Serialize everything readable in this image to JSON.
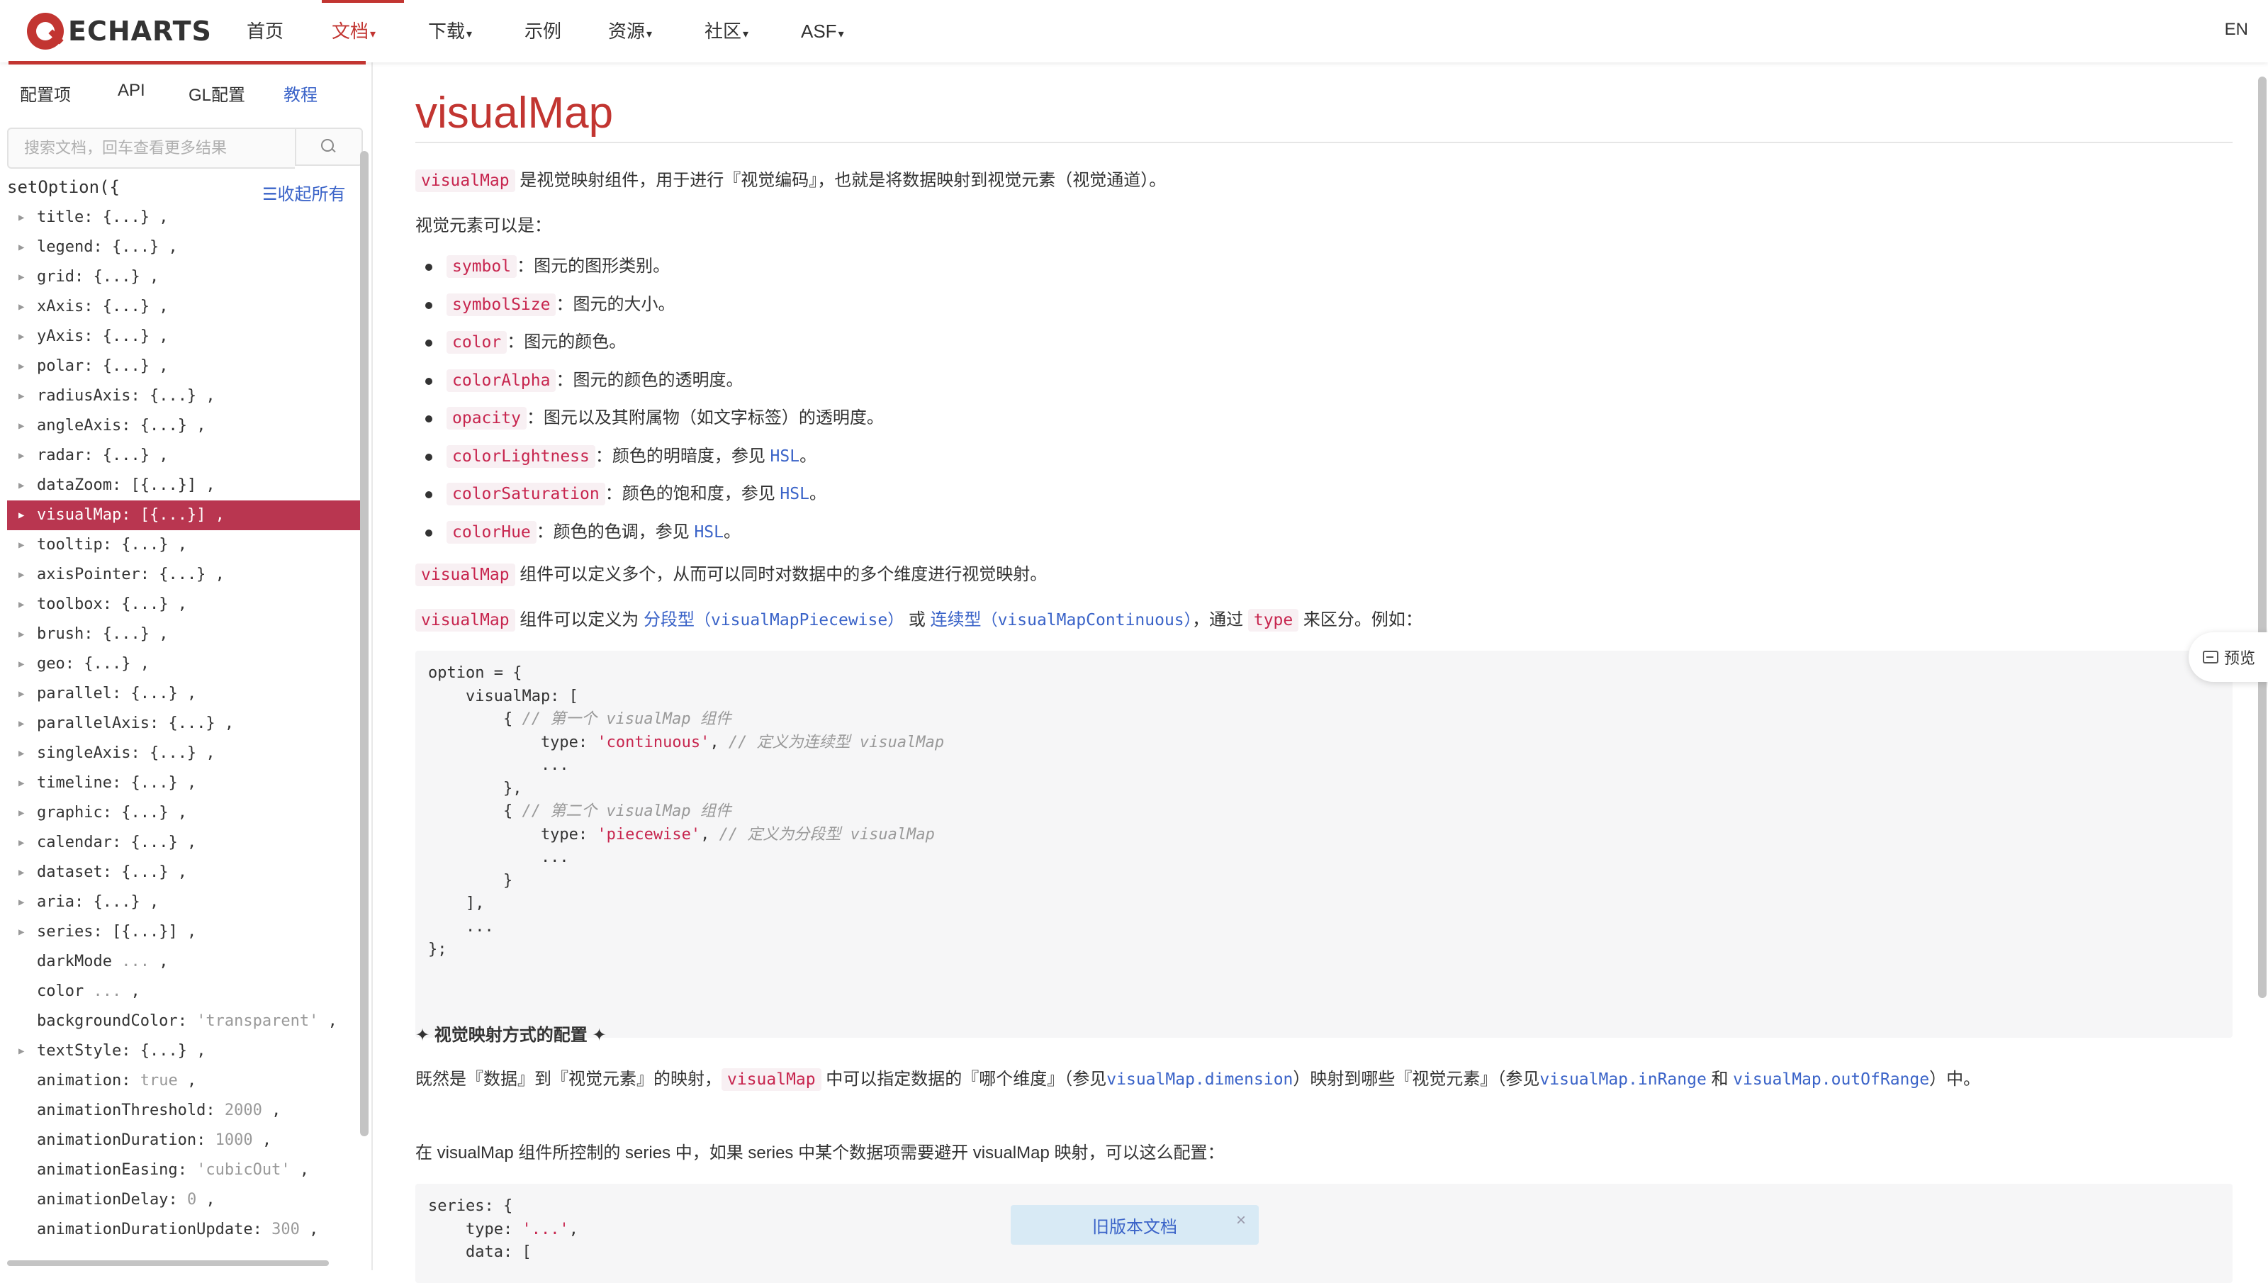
{
  "nav": {
    "logo_text": "ECHARTS",
    "items": [
      {
        "label": "首页",
        "caret": ""
      },
      {
        "label": "文档",
        "caret": "▾"
      },
      {
        "label": "下载",
        "caret": "▾"
      },
      {
        "label": "示例",
        "caret": ""
      },
      {
        "label": "资源",
        "caret": "▾"
      },
      {
        "label": "社区",
        "caret": "▾"
      },
      {
        "label": "ASF",
        "caret": "▾"
      }
    ],
    "lang": "EN",
    "accent": "#c23531"
  },
  "sidebar": {
    "tabs": [
      "配置项",
      "API",
      "GL配置",
      "教程"
    ],
    "search_placeholder": "搜索文档，回车查看更多结果",
    "setoption": "setOption({",
    "collapse_all": "☰收起所有",
    "tree": [
      {
        "key": "title",
        "val": "{...}",
        "arrow": true
      },
      {
        "key": "legend",
        "val": "{...}",
        "arrow": true
      },
      {
        "key": "grid",
        "val": "{...}",
        "arrow": true
      },
      {
        "key": "xAxis",
        "val": "{...}",
        "arrow": true
      },
      {
        "key": "yAxis",
        "val": "{...}",
        "arrow": true
      },
      {
        "key": "polar",
        "val": "{...}",
        "arrow": true
      },
      {
        "key": "radiusAxis",
        "val": "{...}",
        "arrow": true
      },
      {
        "key": "angleAxis",
        "val": "{...}",
        "arrow": true
      },
      {
        "key": "radar",
        "val": "{...}",
        "arrow": true
      },
      {
        "key": "dataZoom",
        "val": "[{...}]",
        "arrow": true
      },
      {
        "key": "visualMap",
        "val": "[{...}]",
        "arrow": true,
        "selected": true
      },
      {
        "key": "tooltip",
        "val": "{...}",
        "arrow": true
      },
      {
        "key": "axisPointer",
        "val": "{...}",
        "arrow": true
      },
      {
        "key": "toolbox",
        "val": "{...}",
        "arrow": true
      },
      {
        "key": "brush",
        "val": "{...}",
        "arrow": true
      },
      {
        "key": "geo",
        "val": "{...}",
        "arrow": true
      },
      {
        "key": "parallel",
        "val": "{...}",
        "arrow": true
      },
      {
        "key": "parallelAxis",
        "val": "{...}",
        "arrow": true
      },
      {
        "key": "singleAxis",
        "val": "{...}",
        "arrow": true
      },
      {
        "key": "timeline",
        "val": "{...}",
        "arrow": true
      },
      {
        "key": "graphic",
        "val": "{...}",
        "arrow": true
      },
      {
        "key": "calendar",
        "val": "{...}",
        "arrow": true
      },
      {
        "key": "dataset",
        "val": "{...}",
        "arrow": true
      },
      {
        "key": "aria",
        "val": "{...}",
        "arrow": true
      },
      {
        "key": "series",
        "val": "[{...}]",
        "arrow": true
      },
      {
        "key": "darkMode",
        "val": "...",
        "arrow": false,
        "plain": true
      },
      {
        "key": "color",
        "val": "...",
        "arrow": false,
        "plain": true
      },
      {
        "key": "backgroundColor",
        "val": "'transparent'",
        "arrow": false,
        "lit": true
      },
      {
        "key": "textStyle",
        "val": "{...}",
        "arrow": true
      },
      {
        "key": "animation",
        "val": "true",
        "arrow": false,
        "lit": true
      },
      {
        "key": "animationThreshold",
        "val": "2000",
        "arrow": false,
        "lit": true
      },
      {
        "key": "animationDuration",
        "val": "1000",
        "arrow": false,
        "lit": true
      },
      {
        "key": "animationEasing",
        "val": "'cubicOut'",
        "arrow": false,
        "lit": true
      },
      {
        "key": "animationDelay",
        "val": "0",
        "arrow": false,
        "lit": true
      },
      {
        "key": "animationDurationUpdate",
        "val": "300",
        "arrow": false,
        "lit": true
      }
    ]
  },
  "main": {
    "title": "visualMap",
    "intro_code": "visualMap",
    "intro_text": " 是视觉映射组件，用于进行『视觉编码』，也就是将数据映射到视觉元素（视觉通道）。",
    "elements_heading": "视觉元素可以是：",
    "bullets": [
      {
        "code": "symbol",
        "text": "：图元的图形类别。",
        "link": ""
      },
      {
        "code": "symbolSize",
        "text": "：图元的大小。",
        "link": ""
      },
      {
        "code": "color",
        "text": "：图元的颜色。",
        "link": ""
      },
      {
        "code": "colorAlpha",
        "text": "：图元的颜色的透明度。",
        "link": ""
      },
      {
        "code": "opacity",
        "text": "：图元以及其附属物（如文字标签）的透明度。",
        "link": ""
      },
      {
        "code": "colorLightness",
        "text": "：颜色的明暗度，参见 ",
        "link": "HSL",
        "tail": "。"
      },
      {
        "code": "colorSaturation",
        "text": "：颜色的饱和度，参见 ",
        "link": "HSL",
        "tail": "。"
      },
      {
        "code": "colorHue",
        "text": "：颜色的色调，参见 ",
        "link": "HSL",
        "tail": "。"
      }
    ],
    "multi_code": "visualMap",
    "multi_text": " 组件可以定义多个，从而可以同时对数据中的多个维度进行视觉映射。",
    "types": {
      "code": "visualMap",
      "t1": " 组件可以定义为 ",
      "link1": "分段型",
      "link1_code": "（visualMapPiecewise）",
      "t2": " 或 ",
      "link2": "连续型",
      "link2_code": "（visualMapContinuous）",
      "t3": "，通过 ",
      "code2": "type",
      "t4": " 来区分。例如："
    },
    "code1": [
      {
        "parts": [
          {
            "t": "option = {",
            "c": ""
          }
        ]
      },
      {
        "parts": [
          {
            "t": "    visualMap: [",
            "c": ""
          }
        ]
      },
      {
        "parts": [
          {
            "t": "        { ",
            "c": ""
          },
          {
            "t": "// 第一个 visualMap 组件",
            "c": "com"
          }
        ]
      },
      {
        "parts": [
          {
            "t": "            type: ",
            "c": ""
          },
          {
            "t": "'continuous'",
            "c": "str"
          },
          {
            "t": ", ",
            "c": ""
          },
          {
            "t": "// 定义为连续型 visualMap",
            "c": "com"
          }
        ]
      },
      {
        "parts": [
          {
            "t": "            ...",
            "c": ""
          }
        ]
      },
      {
        "parts": [
          {
            "t": "        },",
            "c": ""
          }
        ]
      },
      {
        "parts": [
          {
            "t": "        { ",
            "c": ""
          },
          {
            "t": "// 第二个 visualMap 组件",
            "c": "com"
          }
        ]
      },
      {
        "parts": [
          {
            "t": "            type: ",
            "c": ""
          },
          {
            "t": "'piecewise'",
            "c": "str"
          },
          {
            "t": ", ",
            "c": ""
          },
          {
            "t": "// 定义为分段型 visualMap",
            "c": "com"
          }
        ]
      },
      {
        "parts": [
          {
            "t": "            ...",
            "c": ""
          }
        ]
      },
      {
        "parts": [
          {
            "t": "        }",
            "c": ""
          }
        ]
      },
      {
        "parts": [
          {
            "t": "    ],",
            "c": ""
          }
        ]
      },
      {
        "parts": [
          {
            "t": "    ...",
            "c": ""
          }
        ]
      },
      {
        "parts": [
          {
            "t": "};",
            "c": ""
          }
        ]
      }
    ],
    "section_head": "✦ 视觉映射方式的配置 ✦",
    "mapping": {
      "t1": "既然是『数据』到『视觉元素』的映射，",
      "code": "visualMap",
      "t2": " 中可以指定数据的『哪个维度』（参见",
      "link1": "visualMap.dimension",
      "t3": "）映射到哪些『视觉元素』（参见",
      "link2": "visualMap.inRange",
      "t4": " 和 ",
      "link3": "visualMap.outOfRange",
      "t5": "）中。"
    },
    "series_para": "在 visualMap 组件所控制的 series 中，如果 series 中某个数据项需要避开 visualMap 映射，可以这么配置：",
    "code2": [
      {
        "parts": [
          {
            "t": "series: {",
            "c": ""
          }
        ]
      },
      {
        "parts": [
          {
            "t": "    type: ",
            "c": ""
          },
          {
            "t": "'...'",
            "c": "str"
          },
          {
            "t": ",",
            "c": ""
          }
        ]
      },
      {
        "parts": [
          {
            "t": "    data: [",
            "c": ""
          }
        ]
      }
    ],
    "preview_label": "预览",
    "toast_label": "旧版本文档",
    "toast_close": "×"
  }
}
